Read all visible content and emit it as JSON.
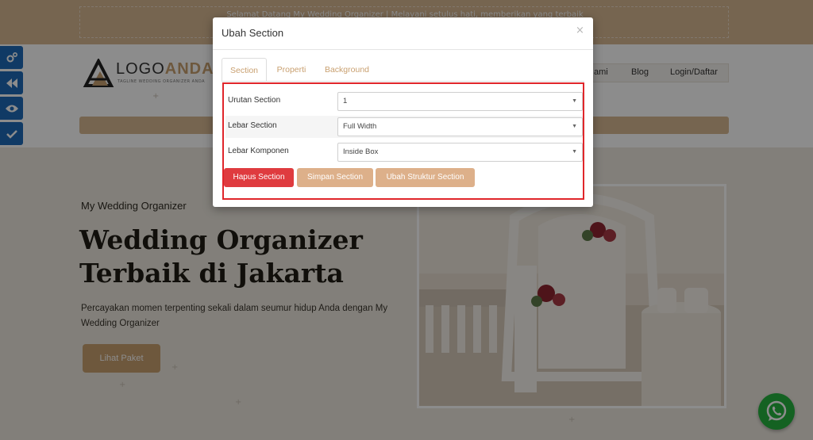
{
  "colors": {
    "accent": "#c9a070",
    "topbar": "#d7b892",
    "danger": "#df3b3f",
    "highlight_border": "#e0262b",
    "editor_rail": "#1e6bb8",
    "whatsapp": "#25b23f"
  },
  "background_page": {
    "topbar_text": "Selamat Datang My Wedding Organizer | Melayani setulus hati, memberikan yang terbaik",
    "logo": {
      "text_main": "LOGO",
      "text_accent": "ANDA",
      "tagline": "TAGLINE WEDDING ORGANIZER ANDA"
    },
    "nav": [
      {
        "label": "ami"
      },
      {
        "label": "Blog"
      },
      {
        "label": "Login/Daftar"
      }
    ],
    "hero": {
      "kicker": "My Wedding Organizer",
      "title_line1": "Wedding Organizer",
      "title_line2": "Terbaik di Jakarta",
      "description": "Percayakan momen terpenting sekali dalam seumur hidup Anda dengan My Wedding Organizer",
      "cta_label": "Lihat Paket"
    }
  },
  "editor_rail": [
    {
      "icon": "gears-icon"
    },
    {
      "icon": "rewind-icon"
    },
    {
      "icon": "eye-icon"
    },
    {
      "icon": "check-icon"
    }
  ],
  "modal": {
    "title": "Ubah Section",
    "close_symbol": "×",
    "tabs": [
      {
        "label": "Section",
        "active": true
      },
      {
        "label": "Properti",
        "active": false
      },
      {
        "label": "Background",
        "active": false
      }
    ],
    "fields": [
      {
        "label": "Urutan Section",
        "value": "1"
      },
      {
        "label": "Lebar Section",
        "value": "Full Width"
      },
      {
        "label": "Lebar Komponen",
        "value": "Inside Box"
      }
    ],
    "buttons": {
      "delete": "Hapus Section",
      "save": "Simpan Section",
      "structure": "Ubah Struktur Section"
    }
  }
}
